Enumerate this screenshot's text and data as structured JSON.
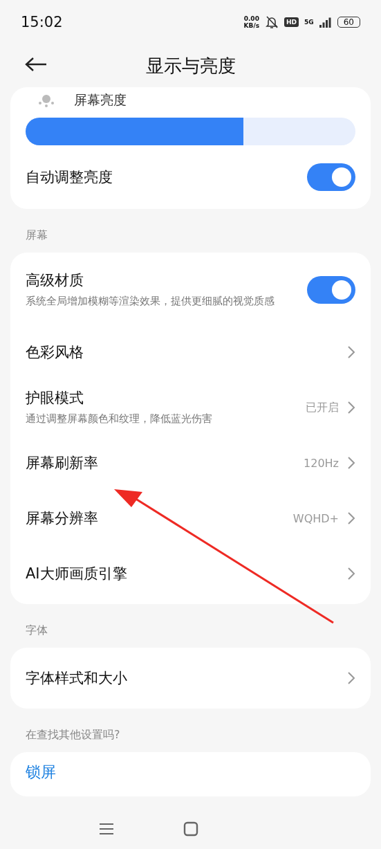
{
  "status_bar": {
    "time": "15:02",
    "net_speed_value": "0.00",
    "net_speed_unit": "KB/s",
    "hd": "HD",
    "network": "5G",
    "battery": "60"
  },
  "header": {
    "title": "显示与亮度"
  },
  "brightness": {
    "label": "屏幕亮度",
    "level": 0.66,
    "auto": {
      "label": "自动调整亮度",
      "on": true
    }
  },
  "sections": [
    {
      "title": "屏幕",
      "rows": [
        {
          "kind": "toggle",
          "label": "高级材质",
          "description": "系统全局增加模糊等渲染效果，提供更细腻的视觉质感",
          "on": true
        },
        {
          "kind": "link",
          "label": "色彩风格"
        },
        {
          "kind": "link",
          "label": "护眼模式",
          "description": "通过调整屏幕颜色和纹理，降低蓝光伤害",
          "value": "已开启"
        },
        {
          "kind": "link",
          "label": "屏幕刷新率",
          "value": "120Hz"
        },
        {
          "kind": "link",
          "label": "屏幕分辨率",
          "value": "WQHD+"
        },
        {
          "kind": "link",
          "label": "AI大师画质引擎"
        }
      ]
    },
    {
      "title": "字体",
      "rows": [
        {
          "kind": "link",
          "label": "字体样式和大小"
        }
      ]
    },
    {
      "title": "在查找其他设置吗?",
      "rows": [
        {
          "kind": "suggestion",
          "label": "锁屏"
        }
      ]
    }
  ]
}
